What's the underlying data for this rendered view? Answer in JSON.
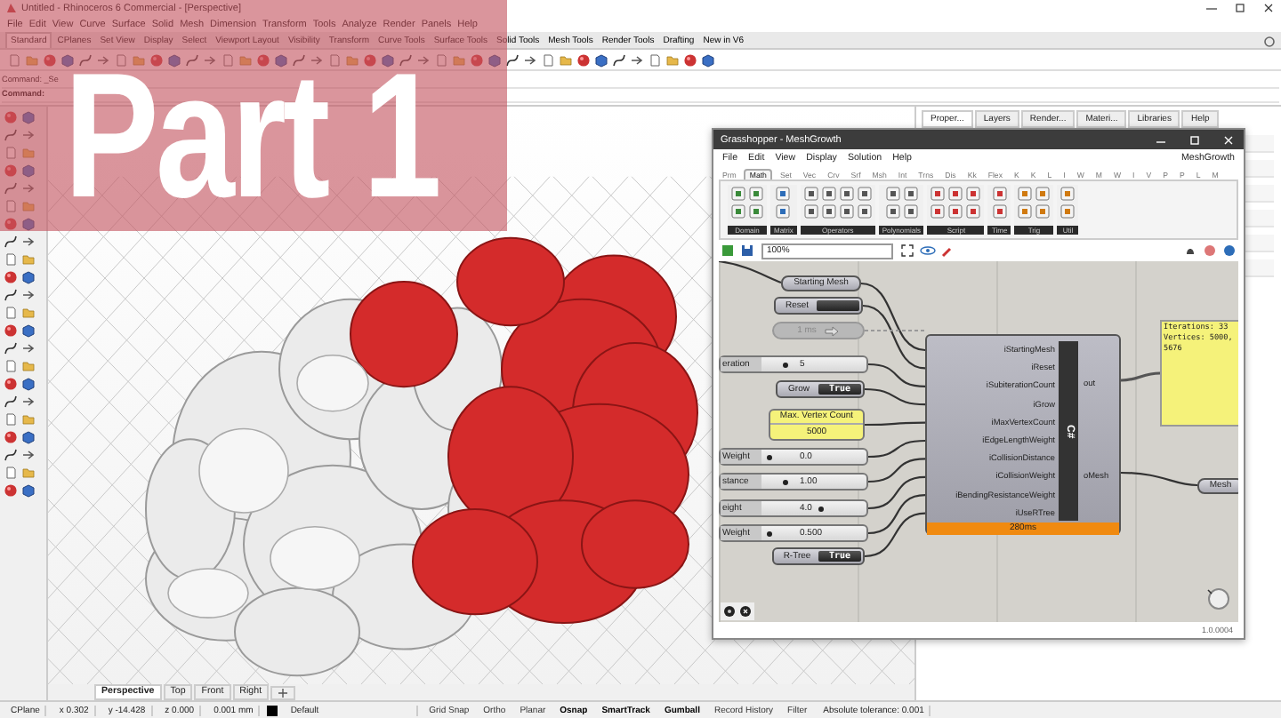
{
  "overlay": {
    "text": "Part 1"
  },
  "rhino": {
    "title": "Untitled - Rhinoceros 6 Commercial - [Perspective]",
    "menu": [
      "File",
      "Edit",
      "View",
      "Curve",
      "Surface",
      "Solid",
      "Mesh",
      "Dimension",
      "Transform",
      "Tools",
      "Analyze",
      "Render",
      "Panels",
      "Help"
    ],
    "toolbar_tabs": [
      {
        "label": "Standard",
        "selected": true
      },
      {
        "label": "CPlanes",
        "selected": false
      },
      {
        "label": "Set View",
        "selected": false
      },
      {
        "label": "Display",
        "selected": false
      },
      {
        "label": "Select",
        "selected": false
      },
      {
        "label": "Viewport Layout",
        "selected": false
      },
      {
        "label": "Visibility",
        "selected": false
      },
      {
        "label": "Transform",
        "selected": false
      },
      {
        "label": "Curve Tools",
        "selected": false
      },
      {
        "label": "Surface Tools",
        "selected": false
      },
      {
        "label": "Solid Tools",
        "selected": false
      },
      {
        "label": "Mesh Tools",
        "selected": false
      },
      {
        "label": "Render Tools",
        "selected": false
      },
      {
        "label": "Drafting",
        "selected": false
      },
      {
        "label": "New in V6",
        "selected": false
      }
    ],
    "command_history": "Command: _Se",
    "command_prompt": "Command:",
    "panel_tabs": [
      {
        "label": "Proper...",
        "selected": true
      },
      {
        "label": "Layers",
        "selected": false
      },
      {
        "label": "Render...",
        "selected": false
      },
      {
        "label": "Materi...",
        "selected": false
      },
      {
        "label": "Libraries",
        "selected": false
      },
      {
        "label": "Help",
        "selected": false
      }
    ],
    "viewport_tabs": [
      {
        "label": "Perspective",
        "selected": true
      },
      {
        "label": "Top",
        "selected": false
      },
      {
        "label": "Front",
        "selected": false
      },
      {
        "label": "Right",
        "selected": false
      }
    ],
    "status_bar": {
      "cplane": "CPlane",
      "x": "x 0.302",
      "y": "y -14.428",
      "z": "z 0.000",
      "units": "0.001 mm",
      "layer": "Default",
      "toggles": [
        {
          "label": "Grid Snap",
          "on": false
        },
        {
          "label": "Ortho",
          "on": false
        },
        {
          "label": "Planar",
          "on": false
        },
        {
          "label": "Osnap",
          "on": true
        },
        {
          "label": "SmartTrack",
          "on": true
        },
        {
          "label": "Gumball",
          "on": true
        },
        {
          "label": "Record History",
          "on": false
        },
        {
          "label": "Filter",
          "on": false
        }
      ],
      "tolerance": "Absolute tolerance: 0.001"
    }
  },
  "grasshopper": {
    "title": "Grasshopper - MeshGrowth",
    "menu": [
      "File",
      "Edit",
      "View",
      "Display",
      "Solution",
      "Help"
    ],
    "document": "MeshGrowth",
    "tabs": [
      {
        "label": "Prm",
        "selected": false
      },
      {
        "label": "Math",
        "selected": true
      },
      {
        "label": "Set",
        "selected": false
      },
      {
        "label": "Vec",
        "selected": false
      },
      {
        "label": "Crv",
        "selected": false
      },
      {
        "label": "Srf",
        "selected": false
      },
      {
        "label": "Msh",
        "selected": false
      },
      {
        "label": "Int",
        "selected": false
      },
      {
        "label": "Trns",
        "selected": false
      },
      {
        "label": "Dis",
        "selected": false
      },
      {
        "label": "Kk",
        "selected": false
      },
      {
        "label": "Flex",
        "selected": false
      },
      {
        "label": "K",
        "selected": false
      },
      {
        "label": "K",
        "selected": false
      },
      {
        "label": "L",
        "selected": false
      },
      {
        "label": "I",
        "selected": false
      },
      {
        "label": "W",
        "selected": false
      },
      {
        "label": "M",
        "selected": false
      },
      {
        "label": "W",
        "selected": false
      },
      {
        "label": "I",
        "selected": false
      },
      {
        "label": "V",
        "selected": false
      },
      {
        "label": "P",
        "selected": false
      },
      {
        "label": "P",
        "selected": false
      },
      {
        "label": "L",
        "selected": false
      },
      {
        "label": "M",
        "selected": false
      }
    ],
    "groups": [
      "Domain",
      "Matrix",
      "Operators",
      "Polynomials",
      "Script",
      "Time",
      "Trig",
      "Util"
    ],
    "zoom": "100%",
    "nodes": [
      {
        "kind": "param",
        "label": "Starting Mesh"
      },
      {
        "kind": "button",
        "label": "Reset"
      },
      {
        "kind": "timer",
        "label": "1 ms"
      },
      {
        "kind": "slider",
        "label": "eration",
        "value": "5",
        "level": 0.2
      },
      {
        "kind": "toggle",
        "label": "Grow",
        "value": "True"
      },
      {
        "kind": "panel",
        "label": "Max. Vertex Count",
        "value": "5000"
      },
      {
        "kind": "slider",
        "label": "Weight",
        "value": "0.0",
        "level": 0.05
      },
      {
        "kind": "slider",
        "label": "stance",
        "value": "1.00",
        "level": 0.2
      },
      {
        "kind": "slider",
        "label": "eight",
        "value": "4.0",
        "level": 0.55
      },
      {
        "kind": "slider",
        "label": "Weight",
        "value": "0.500",
        "level": 0.05
      },
      {
        "kind": "toggle",
        "label": "R-Tree",
        "value": "True"
      }
    ],
    "component": {
      "inputs": [
        "iStartingMesh",
        "iReset",
        "iSubiterationCount",
        "iGrow",
        "iMaxVertexCount",
        "iEdgeLengthWeight",
        "iCollisionDistance",
        "iCollisionWeight",
        "iBendingResistanceWeight",
        "iUseRTree"
      ],
      "outputs": [
        "out",
        "oMesh"
      ],
      "label": "C#",
      "time": "280ms"
    },
    "output_panel": [
      "Iterations: 33",
      "Vertices: 5000,",
      "5676"
    ],
    "output_param": "Mesh",
    "version": "1.0.0004"
  }
}
